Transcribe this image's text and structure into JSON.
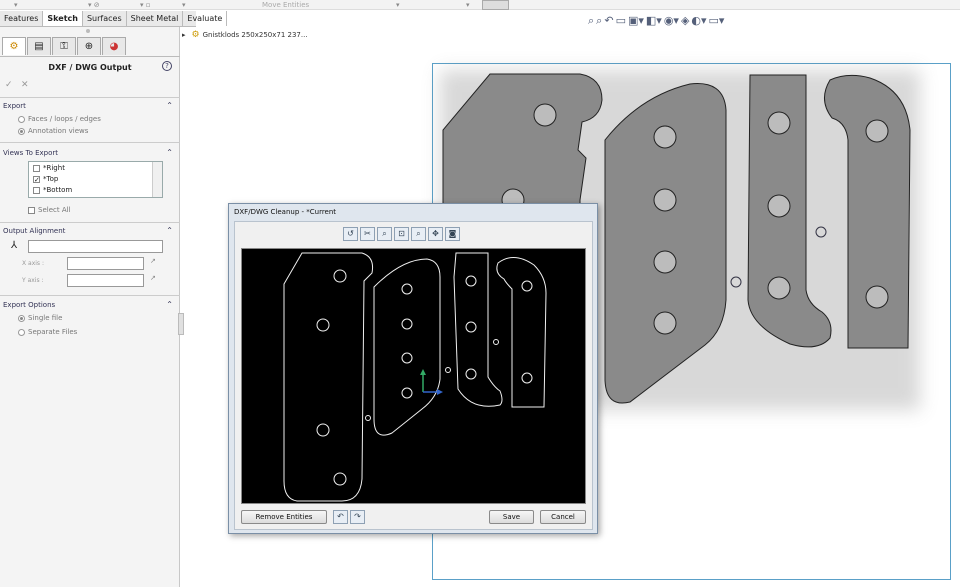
{
  "toolbar_top": {
    "move_entities": "Move Entities"
  },
  "tabs": [
    "Features",
    "Sketch",
    "Surfaces",
    "Sheet Metal",
    "Evaluate"
  ],
  "active_tab": "Sketch",
  "panel": {
    "title": "DXF / DWG Output",
    "export": {
      "heading": "Export",
      "options": [
        "Faces / loops / edges",
        "Annotation views"
      ],
      "selected": "Annotation views"
    },
    "views": {
      "heading": "Views To Export",
      "items": [
        {
          "label": "*Right",
          "checked": false
        },
        {
          "label": "*Top",
          "checked": true
        },
        {
          "label": "*Bottom",
          "checked": false
        }
      ],
      "select_all": "Select All"
    },
    "alignment": {
      "heading": "Output Alignment",
      "x_axis": "X axis :",
      "y_axis": "Y axis :"
    },
    "options": {
      "heading": "Export Options",
      "choices": [
        "Single file",
        "Separate Files"
      ],
      "selected": "Single file"
    }
  },
  "tree": {
    "root_label": "Gnistklods 250x250x71 237..."
  },
  "dialog": {
    "title": "DXF/DWG Cleanup - *Current",
    "remove_button": "Remove Entities",
    "save_button": "Save",
    "cancel_button": "Cancel"
  },
  "colors": {
    "part_fill": "#8a8a8a",
    "viewport_border": "#5aa0c8",
    "canvas_bg": "#000000",
    "accent": "#335"
  }
}
